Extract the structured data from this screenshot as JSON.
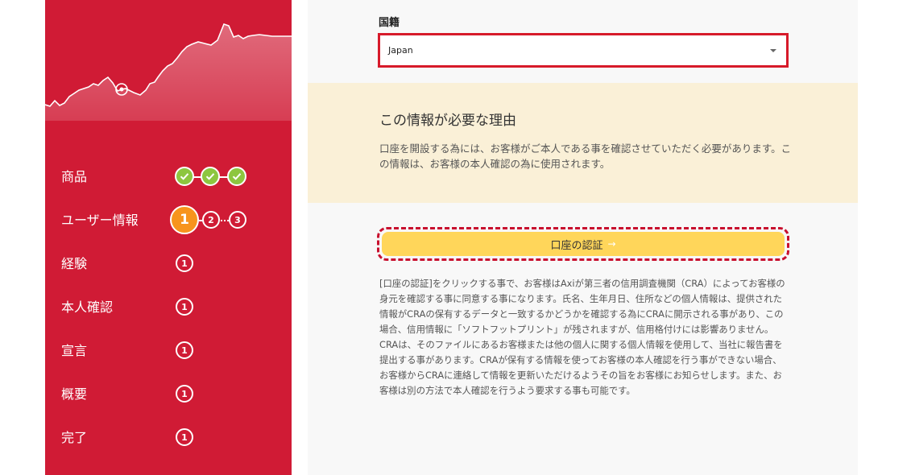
{
  "sidebar": {
    "steps": [
      {
        "label": "商品"
      },
      {
        "label": "ユーザー情報",
        "substeps": [
          "1",
          "2",
          "3"
        ]
      },
      {
        "label": "経験",
        "number": "1"
      },
      {
        "label": "本人確認",
        "number": "1"
      },
      {
        "label": "宣言",
        "number": "1"
      },
      {
        "label": "概要",
        "number": "1"
      },
      {
        "label": "完了",
        "number": "1"
      }
    ]
  },
  "form": {
    "nationality_label": "国籍",
    "nationality_value": "Japan"
  },
  "info": {
    "title": "この情報が必要な理由",
    "text": "口座を開設する為には、お客様がご本人である事を確認させていただく必要があります。この情報は、お客様の本人確認の為に使用されます。"
  },
  "cta": {
    "label": "口座の認証",
    "arrow": "→"
  },
  "legal": {
    "text": "[口座の認証]をクリックする事で、お客様はAxiが第三者の信用調査機関（CRA）によってお客様の身元を確認する事に同意する事になります。氏名、生年月日、住所などの個人情報は、提供された情報がCRAの保有するデータと一致するかどうかを確認する為にCRAに開示される事があり、この場合、信用情報に「ソフトフットプリント」が残されますが、信用格付けには影響ありません。CRAは、そのファイルにあるお客様または他の個人に関する個人情報を使用して、当社に報告書を提出する事があります。CRAが保有する情報を使ってお客様の本人確認を行う事ができない場合、お客様からCRAに連絡して情報を更新いただけるようその旨をお客様にお知らせします。また、お客様は別の方法で本人確認を行うよう要求する事も可能です。"
  },
  "colors": {
    "sidebar": "#d01b35",
    "done": "#8dc63f",
    "active": "#f7941d",
    "cta": "#ffd65a",
    "highlight": "#d71a2a"
  }
}
